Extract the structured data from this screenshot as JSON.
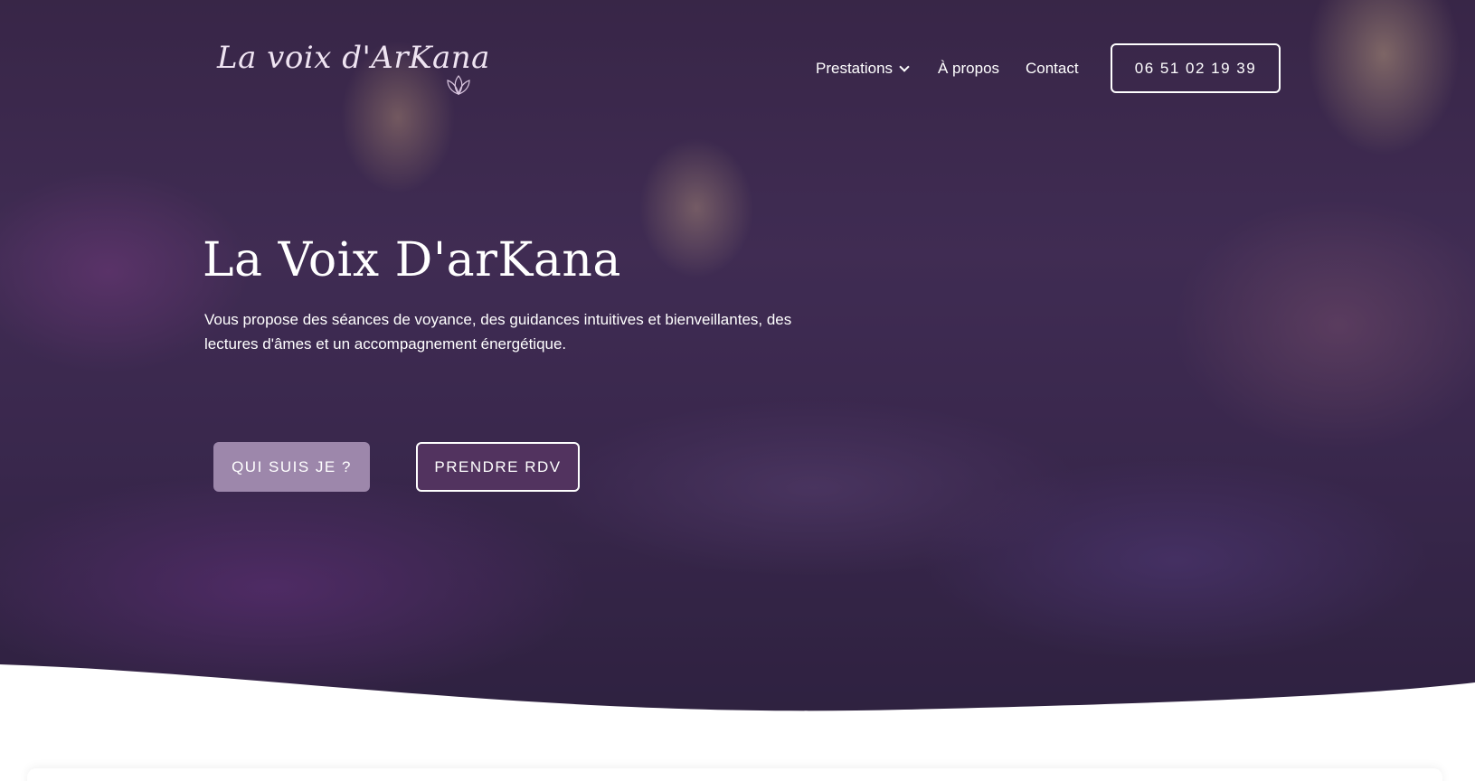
{
  "header": {
    "logo_text": "La voix d'ArKana",
    "nav": {
      "prestations": "Prestations",
      "about": "À propos",
      "contact": "Contact"
    },
    "phone_button": "06 51 02 19 39"
  },
  "hero": {
    "title": "La Voix D'arKana",
    "description": "Vous propose des séances de voyance, des guidances intuitives et bienveillantes, des lectures d'âmes et un accompagnement énergétique.",
    "buttons": {
      "about": "QUI SUIS JE ?",
      "appointment": "PRENDRE RDV"
    }
  },
  "colors": {
    "hero_overlay": "#3f2d55",
    "button_about": "#9d87ab",
    "button_rdv": "#52335f",
    "text": "#ffffff"
  }
}
